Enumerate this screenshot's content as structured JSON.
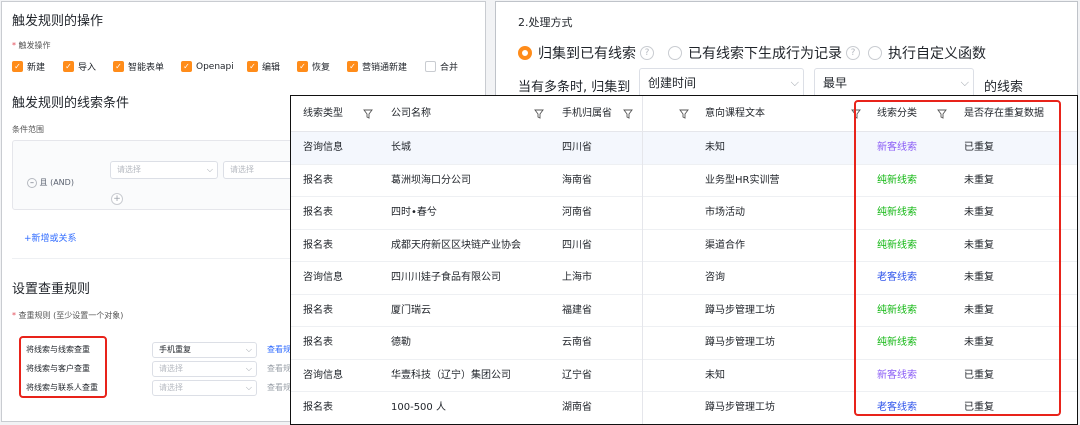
{
  "left_panel": {
    "trigger_ops_title": "触发规则的操作",
    "trigger_ops_label": "触发操作",
    "checkboxes": [
      {
        "label": "新建",
        "checked": true
      },
      {
        "label": "导入",
        "checked": true
      },
      {
        "label": "智能表单",
        "checked": true
      },
      {
        "label": "Openapi",
        "checked": true
      },
      {
        "label": "编辑",
        "checked": true
      },
      {
        "label": "恢复",
        "checked": true
      },
      {
        "label": "营销通新建",
        "checked": true
      },
      {
        "label": "合并",
        "checked": false
      }
    ],
    "cond_title": "触发规则的线索条件",
    "cond_range_label": "条件范围",
    "and_label": "且 (AND)",
    "select_placeholder": "请选择",
    "add_or_link": "+新增或关系",
    "dup_title": "设置查重规则",
    "dup_rule_label": "查重规则 (至少设置一个对象)",
    "dup_rows": [
      {
        "label": "将线索与线索查重",
        "value": "手机重复",
        "link": "查看规"
      },
      {
        "label": "将线索与客户查重",
        "value": "请选择",
        "link": "查看规"
      },
      {
        "label": "将线索与联系人查重",
        "value": "请选择",
        "link": "查看规"
      }
    ]
  },
  "process_panel": {
    "title": "2.处理方式",
    "options": [
      {
        "label": "归集到已有线索",
        "selected": true
      },
      {
        "label": "已有线索下生成行为记录",
        "selected": false
      },
      {
        "label": "执行自定义函数",
        "selected": false
      }
    ],
    "multi_prefix": "当有多条时, 归集到",
    "select1": "创建时间",
    "select2": "最早",
    "suffix": "的线索"
  },
  "table": {
    "columns": [
      "线索类型",
      "公司名称",
      "手机归属省",
      "",
      "意向课程文本",
      "线索分类",
      "是否存在重复数据"
    ],
    "rows": [
      {
        "type": "咨询信息",
        "company": "长城",
        "province": "四川省",
        "course": "未知",
        "category": "新客线索",
        "category_color": "#8a5cf6",
        "dup": "已重复"
      },
      {
        "type": "报名表",
        "company": "葛洲坝海口分公司",
        "province": "海南省",
        "course": "业务型HR实训营",
        "category": "纯新线索",
        "category_color": "#14b814",
        "dup": "未重复"
      },
      {
        "type": "报名表",
        "company": "四时•春兮",
        "province": "河南省",
        "course": "市场活动",
        "category": "纯新线索",
        "category_color": "#14b814",
        "dup": "未重复"
      },
      {
        "type": "报名表",
        "company": "成都天府新区区块链产业协会",
        "province": "四川省",
        "course": "渠道合作",
        "category": "纯新线索",
        "category_color": "#14b814",
        "dup": "未重复"
      },
      {
        "type": "咨询信息",
        "company": "四川川娃子食品有限公司",
        "province": "上海市",
        "course": "咨询",
        "category": "老客线索",
        "category_color": "#2f54eb",
        "dup": "未重复"
      },
      {
        "type": "报名表",
        "company": "厦门瑞云",
        "province": "福建省",
        "course": "蹲马步管理工坊",
        "category": "纯新线索",
        "category_color": "#14b814",
        "dup": "未重复"
      },
      {
        "type": "报名表",
        "company": "德勒",
        "province": "云南省",
        "course": "蹲马步管理工坊",
        "category": "纯新线索",
        "category_color": "#14b814",
        "dup": "未重复"
      },
      {
        "type": "咨询信息",
        "company": "华壹科技（辽宁）集团公司",
        "province": "辽宁省",
        "course": "未知",
        "category": "新客线索",
        "category_color": "#8a5cf6",
        "dup": "已重复"
      },
      {
        "type": "报名表",
        "company": "100-500 人",
        "province": "湖南省",
        "course": "蹲马步管理工坊",
        "category": "老客线索",
        "category_color": "#2f54eb",
        "dup": "已重复"
      }
    ]
  }
}
